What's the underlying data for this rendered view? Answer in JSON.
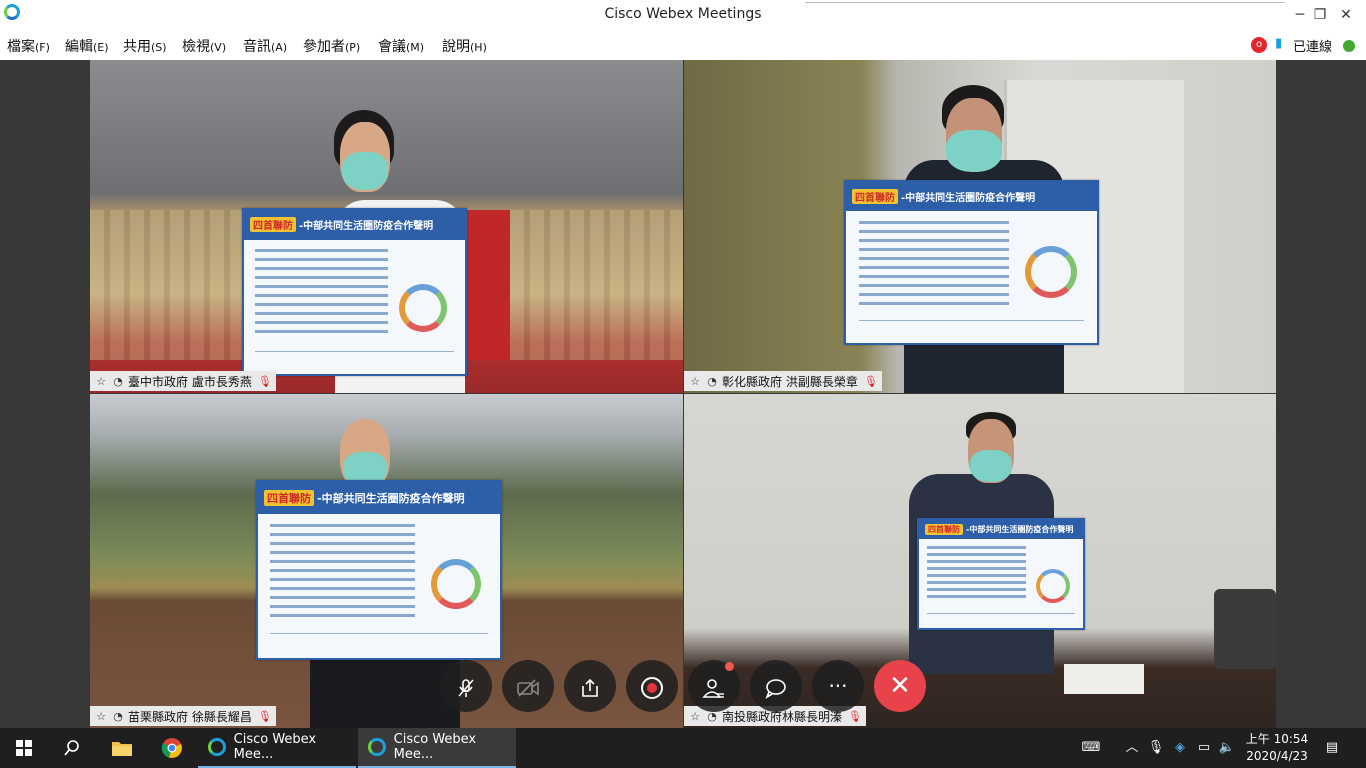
{
  "window": {
    "title": "Cisco Webex Meetings",
    "minimize": "─",
    "restore": "❐",
    "close": "✕"
  },
  "menu": [
    {
      "label": "檔案",
      "key": "(F)"
    },
    {
      "label": "編輯",
      "key": "(E)"
    },
    {
      "label": "共用",
      "key": "(S)"
    },
    {
      "label": "檢視",
      "key": "(V)"
    },
    {
      "label": "音訊",
      "key": "(A)"
    },
    {
      "label": "參加者",
      "key": "(P)"
    },
    {
      "label": "會議",
      "key": "(M)"
    },
    {
      "label": "說明",
      "key": "(H)"
    }
  ],
  "status": {
    "connected": "已連線"
  },
  "participants": [
    {
      "name": "臺中市政府 盧市長秀燕"
    },
    {
      "name": "彰化縣政府 洪副縣長榮章"
    },
    {
      "name": "苗栗縣政府 徐縣長耀昌"
    },
    {
      "name": "南投縣政府林縣長明溱"
    }
  ],
  "sign": {
    "tag": "四首聯防",
    "title": "-中部共同生活圈防疫合作聲明"
  },
  "controls": {
    "mute": "mic-muted-icon",
    "video": "video-off-icon",
    "share": "share-icon",
    "record": "record-icon",
    "participants": "participants-icon",
    "chat": "chat-icon",
    "more": "···",
    "end": "✕"
  },
  "taskbar": {
    "apps": [
      {
        "label": "Cisco Webex Mee..."
      },
      {
        "label": "Cisco Webex Mee..."
      }
    ],
    "time": "上午 10:54",
    "date": "2020/4/23"
  },
  "colors": {
    "accent": "#1ba0d8",
    "end_call": "#e8434a",
    "muted": "#e02020",
    "connected": "#42a830"
  }
}
